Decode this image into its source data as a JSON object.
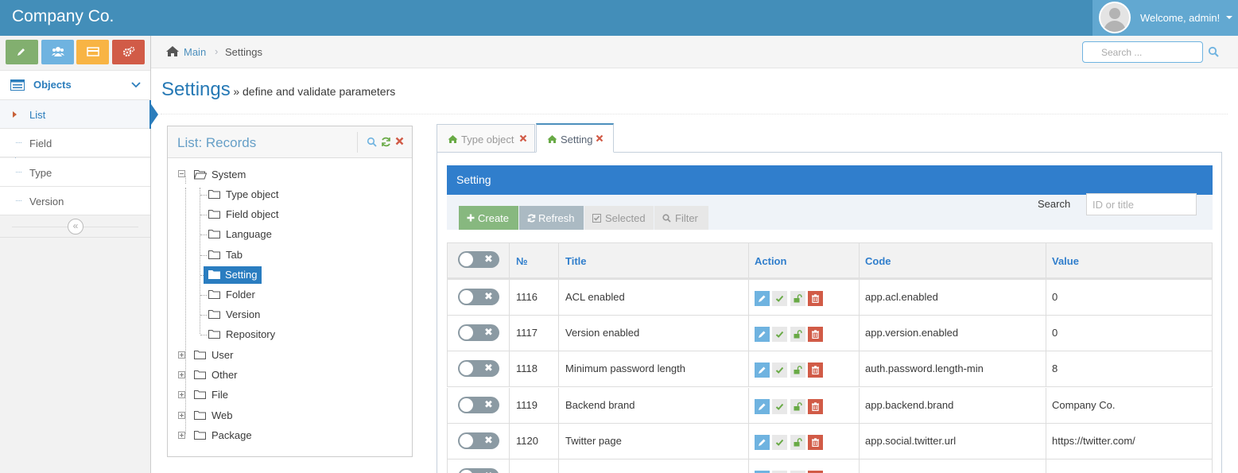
{
  "header": {
    "brand": "Company Co.",
    "welcome": "Welcome, admin!"
  },
  "sidebar": {
    "shortcuts": [
      {
        "icon": "pencil-icon",
        "color": "#82af6f"
      },
      {
        "icon": "users-icon",
        "color": "#6fb3e0"
      },
      {
        "icon": "card-icon",
        "color": "#f8b444"
      },
      {
        "icon": "cogs-icon",
        "color": "#d15b47"
      }
    ],
    "section": "Objects",
    "items": [
      {
        "label": "List",
        "active": true
      },
      {
        "label": "Field"
      },
      {
        "label": "Type"
      },
      {
        "label": "Version"
      }
    ]
  },
  "breadcrumb": {
    "home": "Main",
    "current": "Settings"
  },
  "search": {
    "placeholder": "Search ..."
  },
  "page": {
    "title": "Settings",
    "subtitle": "» define and validate parameters"
  },
  "tree_widget": {
    "title": "List: Records",
    "root": "System",
    "children": [
      "Type object",
      "Field object",
      "Language",
      "Tab",
      "Setting",
      "Folder",
      "Version",
      "Repository"
    ],
    "selected": "Setting",
    "others": [
      "User",
      "Other",
      "File",
      "Web",
      "Package"
    ]
  },
  "tabs": [
    {
      "label": "Type object",
      "active": false
    },
    {
      "label": "Setting",
      "active": true
    }
  ],
  "panel": {
    "title": "Setting",
    "toolbar": {
      "create": "Create",
      "refresh": "Refresh",
      "selected": "Selected",
      "filter": "Filter",
      "search_label": "Search",
      "search_placeholder": "ID or title"
    },
    "columns": [
      "№",
      "Title",
      "Action",
      "Code",
      "Value"
    ],
    "rows": [
      {
        "id": "1116",
        "title": "ACL enabled",
        "code": "app.acl.enabled",
        "value": "0"
      },
      {
        "id": "1117",
        "title": "Version enabled",
        "code": "app.version.enabled",
        "value": "0"
      },
      {
        "id": "1118",
        "title": "Minimum password length",
        "code": "auth.password.length-min",
        "value": "8"
      },
      {
        "id": "1119",
        "title": "Backend brand",
        "code": "app.backend.brand",
        "value": "Company Co."
      },
      {
        "id": "1120",
        "title": "Twitter page",
        "code": "app.social.twitter.url",
        "value": "https://twitter.com/"
      },
      {
        "id": "",
        "title": "",
        "code": "",
        "value": ""
      }
    ]
  },
  "colors": {
    "topbar": "#438eb9",
    "accent": "#2679b5",
    "panel_head": "#307ecc"
  }
}
